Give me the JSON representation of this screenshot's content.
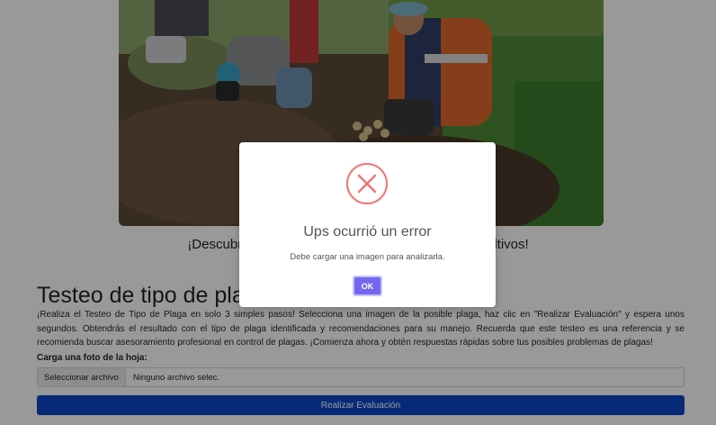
{
  "hero": {
    "alt": ""
  },
  "main": {
    "subtitle": "¡Descubre y combate las plagas que afectan tus cultivos!",
    "section_title": "Testeo de tipo de plaga",
    "description": "¡Realiza el Testeo de Tipo de Plaga en solo 3 simples pasos! Selecciona una imagen de la posible plaga, haz clic en \"Realizar Evaluación\" y espera unos segundos. Obtendrás el resultado con el tipo de plaga identificada y recomendaciones para su manejo. Recuerda que este testeo es una referencia y se recomienda buscar asesoramiento profesional en control de plagas. ¡Comienza ahora y obtén respuestas rápidas sobre tus posibles problemas de plagas!",
    "upload_label": "Carga una foto de la hoja:",
    "file_button": "Seleccionar archivo",
    "file_name": "Ninguno archivo selec.",
    "submit_label": "Realizar Evaluación"
  },
  "modal": {
    "icon": "error-x-icon",
    "title": "Ups ocurrió un error",
    "message": "Debe cargar una imagen para analizarla.",
    "ok_label": "OK"
  },
  "colors": {
    "primary_button": "#0d47c9",
    "ok_button": "#7367f0",
    "error_icon": "#f27474",
    "overlay": "rgba(0,0,0,0.4)"
  }
}
